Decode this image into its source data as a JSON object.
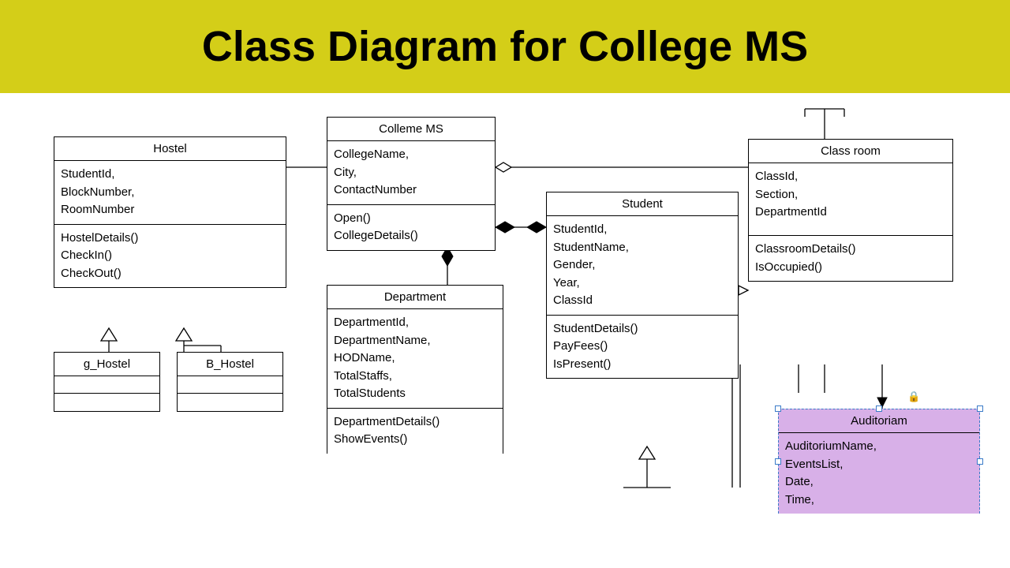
{
  "title": "Class Diagram for College MS",
  "classes": {
    "hostel": {
      "name": "Hostel",
      "attrs": " StudentId,\nBlockNumber,\nRoomNumber",
      "ops": "HostelDetails()\nCheckIn()\nCheckOut()"
    },
    "collegems": {
      "name": "Colleme MS",
      "attrs": "CollegeName,\nCity,\nContactNumber",
      "ops": "Open()\nCollegeDetails()"
    },
    "classroom": {
      "name": "Class room",
      "attrs": "ClassId,\nSection,\nDepartmentId",
      "ops": "ClassroomDetails()\nIsOccupied()"
    },
    "student": {
      "name": "Student",
      "attrs": "StudentId,\nStudentName,\nGender,\nYear,\nClassId",
      "ops": "StudentDetails()\nPayFees()\nIsPresent()"
    },
    "department": {
      "name": "Department",
      "attrs": "DepartmentId,\nDepartmentName,\nHODName,\nTotalStaffs,\nTotalStudents",
      "ops": "DepartmentDetails()\nShowEvents()"
    },
    "ghostel": {
      "name": "g_Hostel"
    },
    "bhostel": {
      "name": "B_Hostel"
    },
    "auditorium": {
      "name": "Auditoriam",
      "attrs": "AuditoriumName,\n EventsList,\nDate,\nTime,"
    }
  },
  "lock": "🔒"
}
